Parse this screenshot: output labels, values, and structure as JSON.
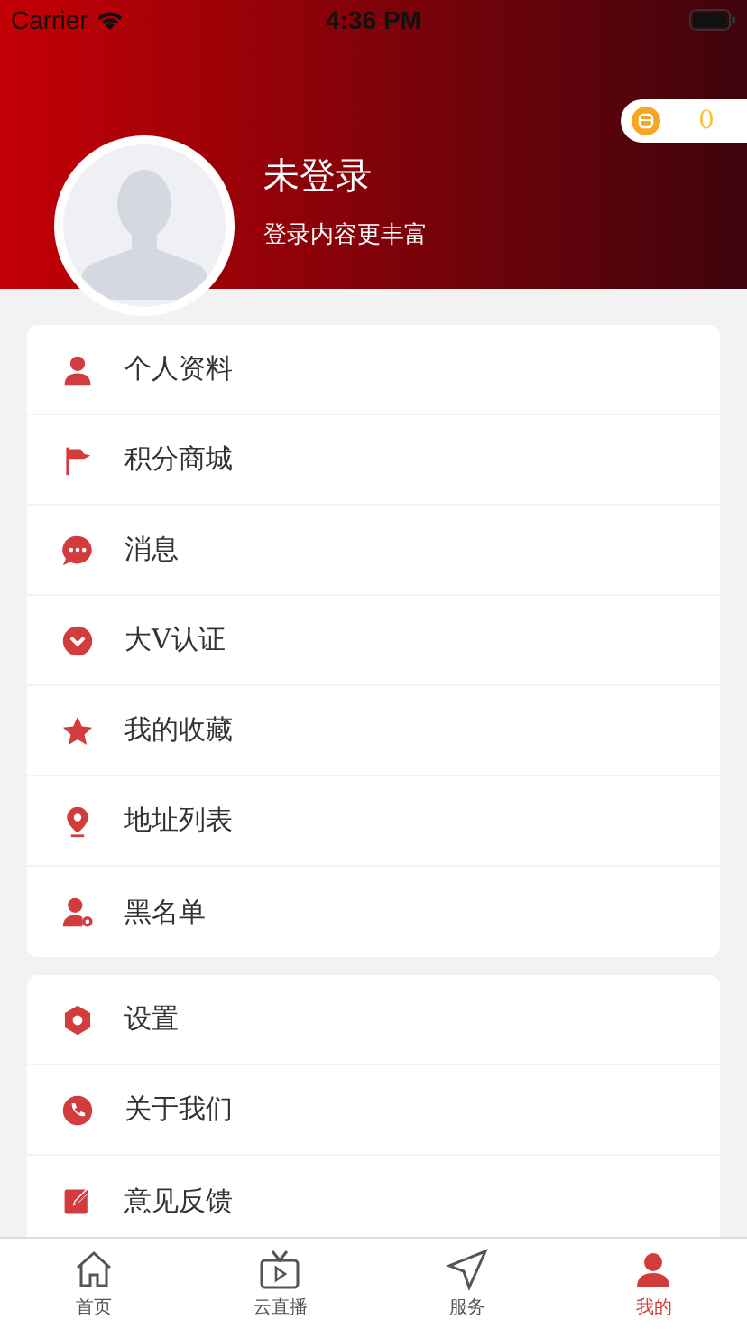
{
  "status_bar": {
    "carrier": "Carrier",
    "time": "4:36 PM"
  },
  "coins": {
    "count": "0"
  },
  "profile": {
    "name": "未登录",
    "subtitle": "登录内容更丰富"
  },
  "sections": [
    {
      "items": [
        {
          "label": "个人资料"
        },
        {
          "label": "积分商城"
        },
        {
          "label": "消息"
        },
        {
          "label": "大V认证"
        },
        {
          "label": "我的收藏"
        },
        {
          "label": "地址列表"
        },
        {
          "label": "黑名单"
        }
      ]
    },
    {
      "items": [
        {
          "label": "设置"
        },
        {
          "label": "关于我们"
        },
        {
          "label": "意见反馈"
        }
      ]
    }
  ],
  "tab_bar": [
    {
      "label": "首页",
      "selected": false
    },
    {
      "label": "云直播",
      "selected": false
    },
    {
      "label": "服务",
      "selected": false
    },
    {
      "label": "我的",
      "selected": true
    }
  ]
}
